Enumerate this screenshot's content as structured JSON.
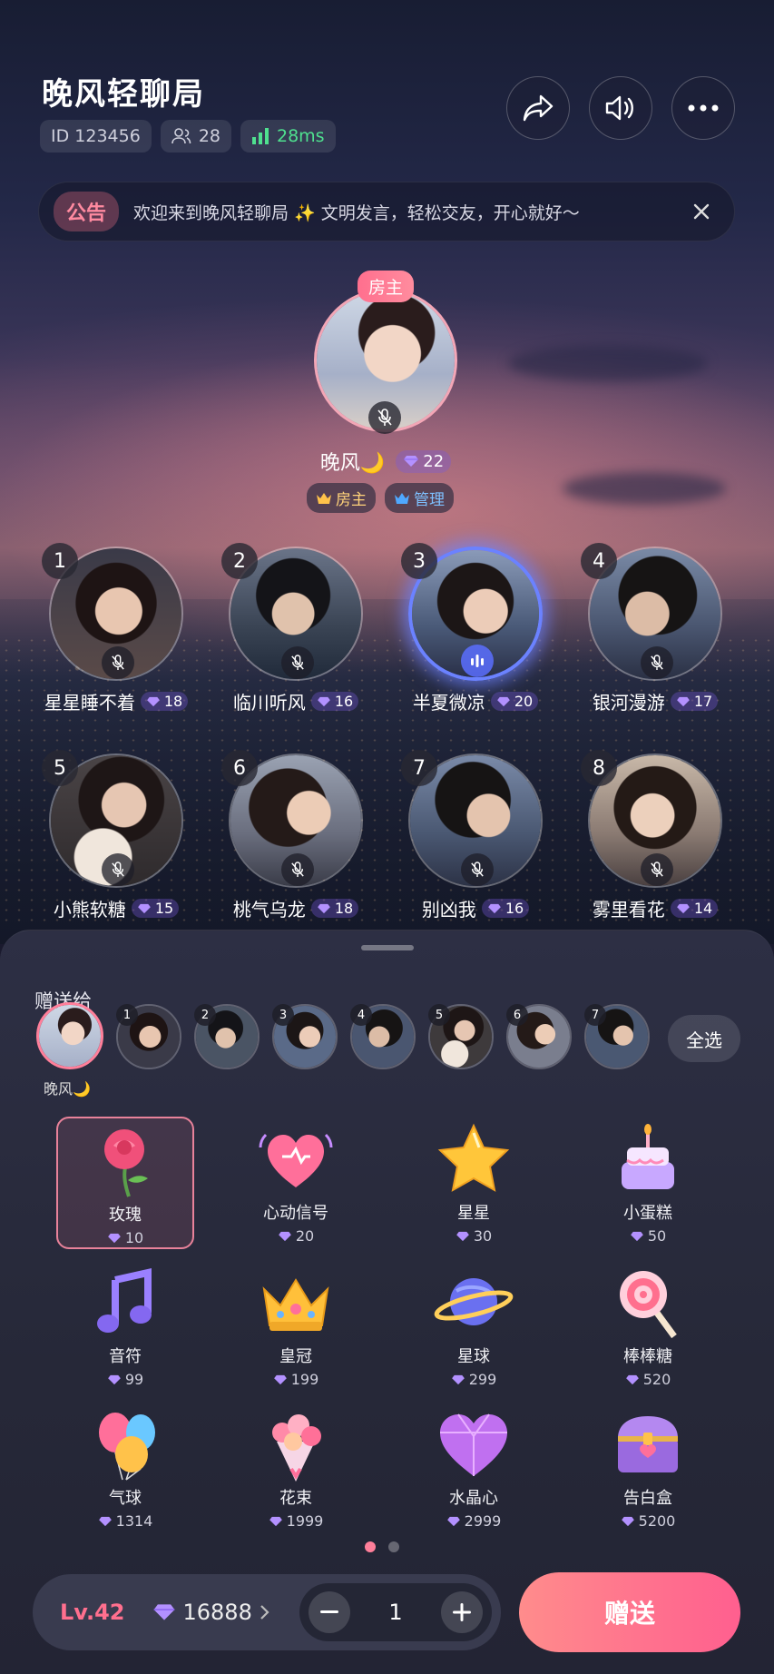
{
  "room": {
    "title": "晚风轻聊局",
    "id_label": "ID 123456",
    "online_count": "28",
    "ping": "28ms"
  },
  "icons": {
    "share": "share-icon",
    "sound": "speaker-icon",
    "more": "more-icon",
    "close": "close-icon",
    "users": "users-icon",
    "signal": "signal-icon",
    "gem": "gem-icon",
    "mic_off": "mic-off-icon",
    "mic_on": "mic-active-icon"
  },
  "notice": {
    "tag": "公告",
    "text": "欢迎来到晚风轻聊局 ✨ 文明发言，轻松交友，开心就好～"
  },
  "host": {
    "badge": "房主",
    "name": "晚风🌙",
    "gems": "22",
    "roles": [
      "房主",
      "管理"
    ]
  },
  "seats": [
    {
      "num": "1",
      "name": "星星睡不着",
      "gems": "18"
    },
    {
      "num": "2",
      "name": "临川听风",
      "gems": "16"
    },
    {
      "num": "3",
      "name": "半夏微凉",
      "gems": "20"
    },
    {
      "num": "4",
      "name": "银河漫游",
      "gems": "17"
    },
    {
      "num": "5",
      "name": "小熊软糖",
      "gems": "15"
    },
    {
      "num": "6",
      "name": "桃气乌龙",
      "gems": "18"
    },
    {
      "num": "7",
      "name": "别凶我",
      "gems": "16"
    },
    {
      "num": "8",
      "name": "雾里看花",
      "gems": "14"
    }
  ],
  "sheet": {
    "send_to": "赠送给",
    "selected_name": "晚风🌙",
    "receivers": [
      "1",
      "2",
      "3",
      "4",
      "5",
      "6",
      "7"
    ],
    "select_all": "全选"
  },
  "gifts": [
    {
      "name": "玫瑰",
      "price": "10"
    },
    {
      "name": "心动信号",
      "price": "20"
    },
    {
      "name": "星星",
      "price": "30"
    },
    {
      "name": "小蛋糕",
      "price": "50"
    },
    {
      "name": "音符",
      "price": "99"
    },
    {
      "name": "皇冠",
      "price": "199"
    },
    {
      "name": "星球",
      "price": "299"
    },
    {
      "name": "棒棒糖",
      "price": "520"
    },
    {
      "name": "气球",
      "price": "1314"
    },
    {
      "name": "花束",
      "price": "1999"
    },
    {
      "name": "水晶心",
      "price": "2999"
    },
    {
      "name": "告白盒",
      "price": "5200"
    }
  ],
  "footer": {
    "level": "Lv.42",
    "balance": "16888",
    "quantity": "1",
    "send": "赠送"
  },
  "colors": {
    "accent": "#ff6f8e",
    "gem": "#9b7bff",
    "ping": "#4fe08f"
  }
}
